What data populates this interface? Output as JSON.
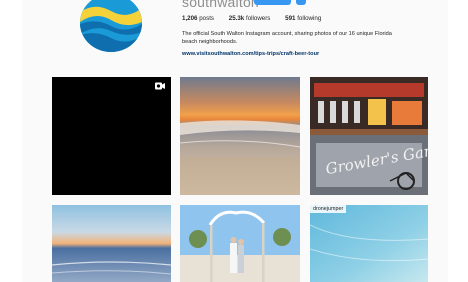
{
  "profile": {
    "username": "southwalton",
    "stats": [
      {
        "value": "1,206",
        "label": "posts"
      },
      {
        "value": "25.3k",
        "label": "followers"
      },
      {
        "value": "591",
        "label": "following"
      }
    ],
    "bio_line1": "The official South Walton Instagram account, sharing photos of our 16 unique Florida",
    "bio_line2": "beach neighborhoods.",
    "link": "www.visitsouthwalton.com/tips-trips/craft-beer-tour"
  },
  "grid": {
    "tiles": [
      {
        "name": "video-post",
        "kind": "video"
      },
      {
        "name": "sunset-beach-post",
        "kind": "photo"
      },
      {
        "name": "brewery-post",
        "kind": "photo",
        "sign_text": "Growler's Garage"
      },
      {
        "name": "ocean-sunset-post",
        "kind": "photo"
      },
      {
        "name": "beach-wedding-post",
        "kind": "photo"
      },
      {
        "name": "water-sand-post",
        "kind": "photo",
        "tag": "dronejumper"
      }
    ]
  },
  "colors": {
    "accent": "#3897f0",
    "link": "#003569",
    "muted": "#8e8e8e"
  }
}
